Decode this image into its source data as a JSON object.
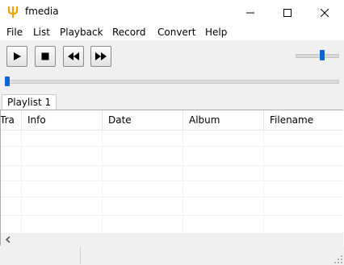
{
  "window": {
    "title": "fmedia",
    "icon": "fmedia-logo-icon",
    "controls": [
      "minimize-icon",
      "maximize-icon",
      "close-icon"
    ]
  },
  "menu": {
    "items": [
      "File",
      "List",
      "Playback",
      "Record",
      "Convert",
      "Help"
    ]
  },
  "toolbar": {
    "buttons": [
      "play-icon",
      "stop-icon",
      "rewind-icon",
      "fast-forward-icon"
    ],
    "volume_level": 0.65,
    "seek_position": 0.0,
    "accent_color": "#0a66d1"
  },
  "tabs": {
    "items": [
      "Playlist 1"
    ],
    "active": 0
  },
  "playlist": {
    "columns": [
      "Tra",
      "Info",
      "Date",
      "Album",
      "Filename"
    ],
    "rows": []
  },
  "statusbar": {
    "parts": [
      "",
      ""
    ]
  }
}
